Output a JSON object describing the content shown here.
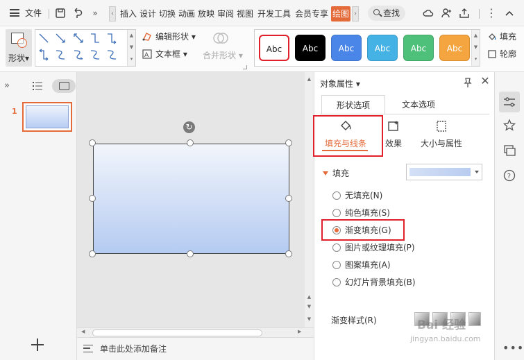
{
  "menubar": {
    "file_label": "文件",
    "tabs": [
      "插入",
      "设计",
      "切换",
      "动画",
      "放映",
      "审阅",
      "视图",
      "开发工具",
      "会员专享",
      "绘图"
    ],
    "active_tab": "绘图",
    "search_label": "查找"
  },
  "ribbon": {
    "shape_label": "形状",
    "edit_shape_label": "编辑形状",
    "textbox_label": "文本框",
    "merge_shape_label": "合并形状",
    "style_samples": [
      {
        "label": "Abc",
        "bg": "#ffffff",
        "fg": "#222222",
        "border": "#e0202a"
      },
      {
        "label": "Abc",
        "bg": "#000000",
        "fg": "#ffffff",
        "border": "#000000"
      },
      {
        "label": "Abc",
        "bg": "#4a86e8",
        "fg": "#ffffff",
        "border": "#3d73c9"
      },
      {
        "label": "Abc",
        "bg": "#45b2e6",
        "fg": "#ffffff",
        "border": "#3a9bc9"
      },
      {
        "label": "Abc",
        "bg": "#4fc07a",
        "fg": "#ffffff",
        "border": "#3fa566"
      },
      {
        "label": "Abc",
        "bg": "#f5a540",
        "fg": "#ffffff",
        "border": "#d88d30"
      }
    ],
    "fill_label": "填充",
    "outline_label": "轮廓"
  },
  "thumbs": {
    "slide_number": "1"
  },
  "notes": {
    "placeholder": "单击此处添加备注"
  },
  "panel": {
    "title": "对象属性",
    "tabs": [
      "形状选项",
      "文本选项"
    ],
    "subtabs": [
      "填充与线条",
      "效果",
      "大小与属性"
    ],
    "fill_section": "填充",
    "fill_options": [
      {
        "label": "无填充(N)",
        "checked": false
      },
      {
        "label": "纯色填充(S)",
        "checked": false
      },
      {
        "label": "渐变填充(G)",
        "checked": true
      },
      {
        "label": "图片或纹理填充(P)",
        "checked": false
      },
      {
        "label": "图案填充(A)",
        "checked": false
      },
      {
        "label": "幻灯片背景填充(B)",
        "checked": false
      }
    ],
    "gradient_style_label": "渐变样式(R)"
  },
  "watermark": {
    "text": "Bai 经验",
    "url": "jingyan.baidu.com"
  },
  "colors": {
    "accent": "#e46a3a",
    "highlight": "#e0202a"
  }
}
